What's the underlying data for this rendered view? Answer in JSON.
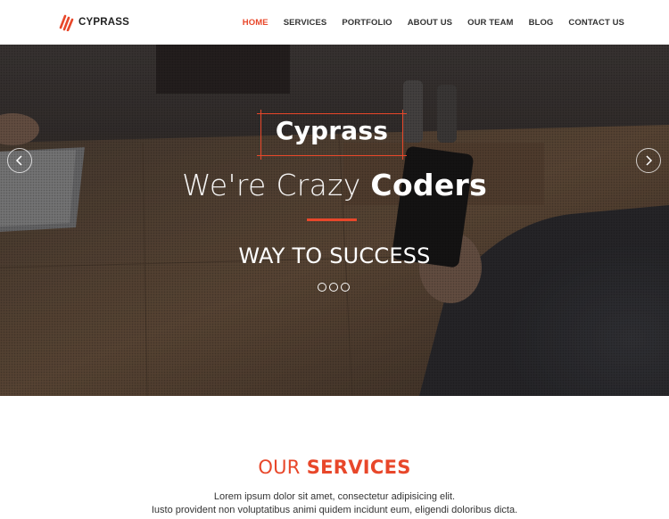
{
  "header": {
    "logo_text": "CYPRASS",
    "nav": [
      {
        "label": "HOME",
        "active": true
      },
      {
        "label": "SERVICES",
        "active": false
      },
      {
        "label": "PORTFOLIO",
        "active": false
      },
      {
        "label": "ABOUT US",
        "active": false
      },
      {
        "label": "OUR TEAM",
        "active": false
      },
      {
        "label": "BLOG",
        "active": false
      },
      {
        "label": "CONTACT US",
        "active": false
      }
    ]
  },
  "hero": {
    "brand": "Cyprass",
    "headline_light": "We're Crazy ",
    "headline_bold": "Coders",
    "tagline": "WAY TO SUCCESS",
    "slide_count": 3,
    "prev_icon": "chevron-left-icon",
    "next_icon": "chevron-right-icon"
  },
  "services": {
    "title_light": "OUR ",
    "title_bold": "SERVICES",
    "desc_line1": "Lorem ipsum dolor sit amet, consectetur adipisicing elit.",
    "desc_line2": "Iusto provident non voluptatibus animi quidem incidunt eum, eligendi doloribus dicta."
  },
  "colors": {
    "accent": "#e8472a",
    "nav_text": "#333333",
    "hero_text": "#ffffff"
  }
}
